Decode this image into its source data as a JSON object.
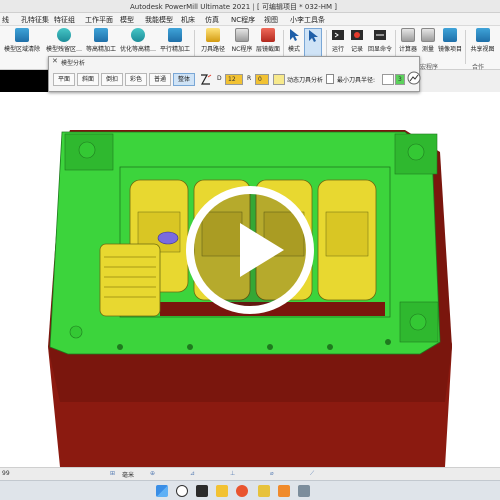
{
  "app": {
    "title": "Autodesk PowerMill Ultimate 2021",
    "project": "[ 可编辑项目 * 032-HM ]"
  },
  "menu": [
    "线",
    "孔特征集",
    "特征组",
    "工作平面",
    "模型",
    "我能模型",
    "机床",
    "仿真",
    "NC程序",
    "视图",
    "小李工具条"
  ],
  "ribbon": {
    "buttons": [
      {
        "label": "模型区域清除",
        "icon": "layers-icon"
      },
      {
        "label": "模型残留区…",
        "icon": "layers-icon"
      },
      {
        "label": "等高精加工",
        "icon": "stack-icon"
      },
      {
        "label": "优化等高精…",
        "icon": "stack-icon"
      },
      {
        "label": "平行精加工",
        "icon": "grid-icon"
      },
      {
        "label": "刀具路径",
        "icon": "toolpath-icon"
      },
      {
        "label": "NC程序",
        "icon": "nc-program-icon"
      },
      {
        "label": "层镜截面",
        "icon": "section-icon"
      },
      {
        "label": "模式",
        "icon": "cursor-icon"
      },
      {
        "label": "运行",
        "icon": "run-icon"
      },
      {
        "label": "记录",
        "icon": "record-icon"
      },
      {
        "label": "回显命令",
        "icon": "echo-icon"
      },
      {
        "label": "计算器",
        "icon": "calculator-icon"
      },
      {
        "label": "测量",
        "icon": "measure-icon"
      },
      {
        "label": "镜像项目",
        "icon": "mirror-icon"
      },
      {
        "label": "共享视图",
        "icon": "share-view-icon"
      }
    ],
    "group_labels": [
      "宏程序",
      "合作"
    ]
  },
  "analysis_toolbar": {
    "title": "模型分析",
    "buttons": [
      "平面",
      "斜面",
      "倒扣",
      "彩色",
      "普通",
      "整体"
    ],
    "active": "整体",
    "d_label": "D",
    "d_value": "12",
    "r_label": "R",
    "r_value": "0",
    "dynamic_label": "动态刀具分析",
    "min_radius_label": "最小刀具半径:",
    "min_radius_value": "3"
  },
  "statusbar": {
    "value": "99",
    "unit": "毫米"
  },
  "colors": {
    "mold_base": "#3cd43c",
    "mold_shadow": "#8b1a10",
    "cavity_parts": "#e8d830",
    "accent": "#1f6fa8"
  }
}
